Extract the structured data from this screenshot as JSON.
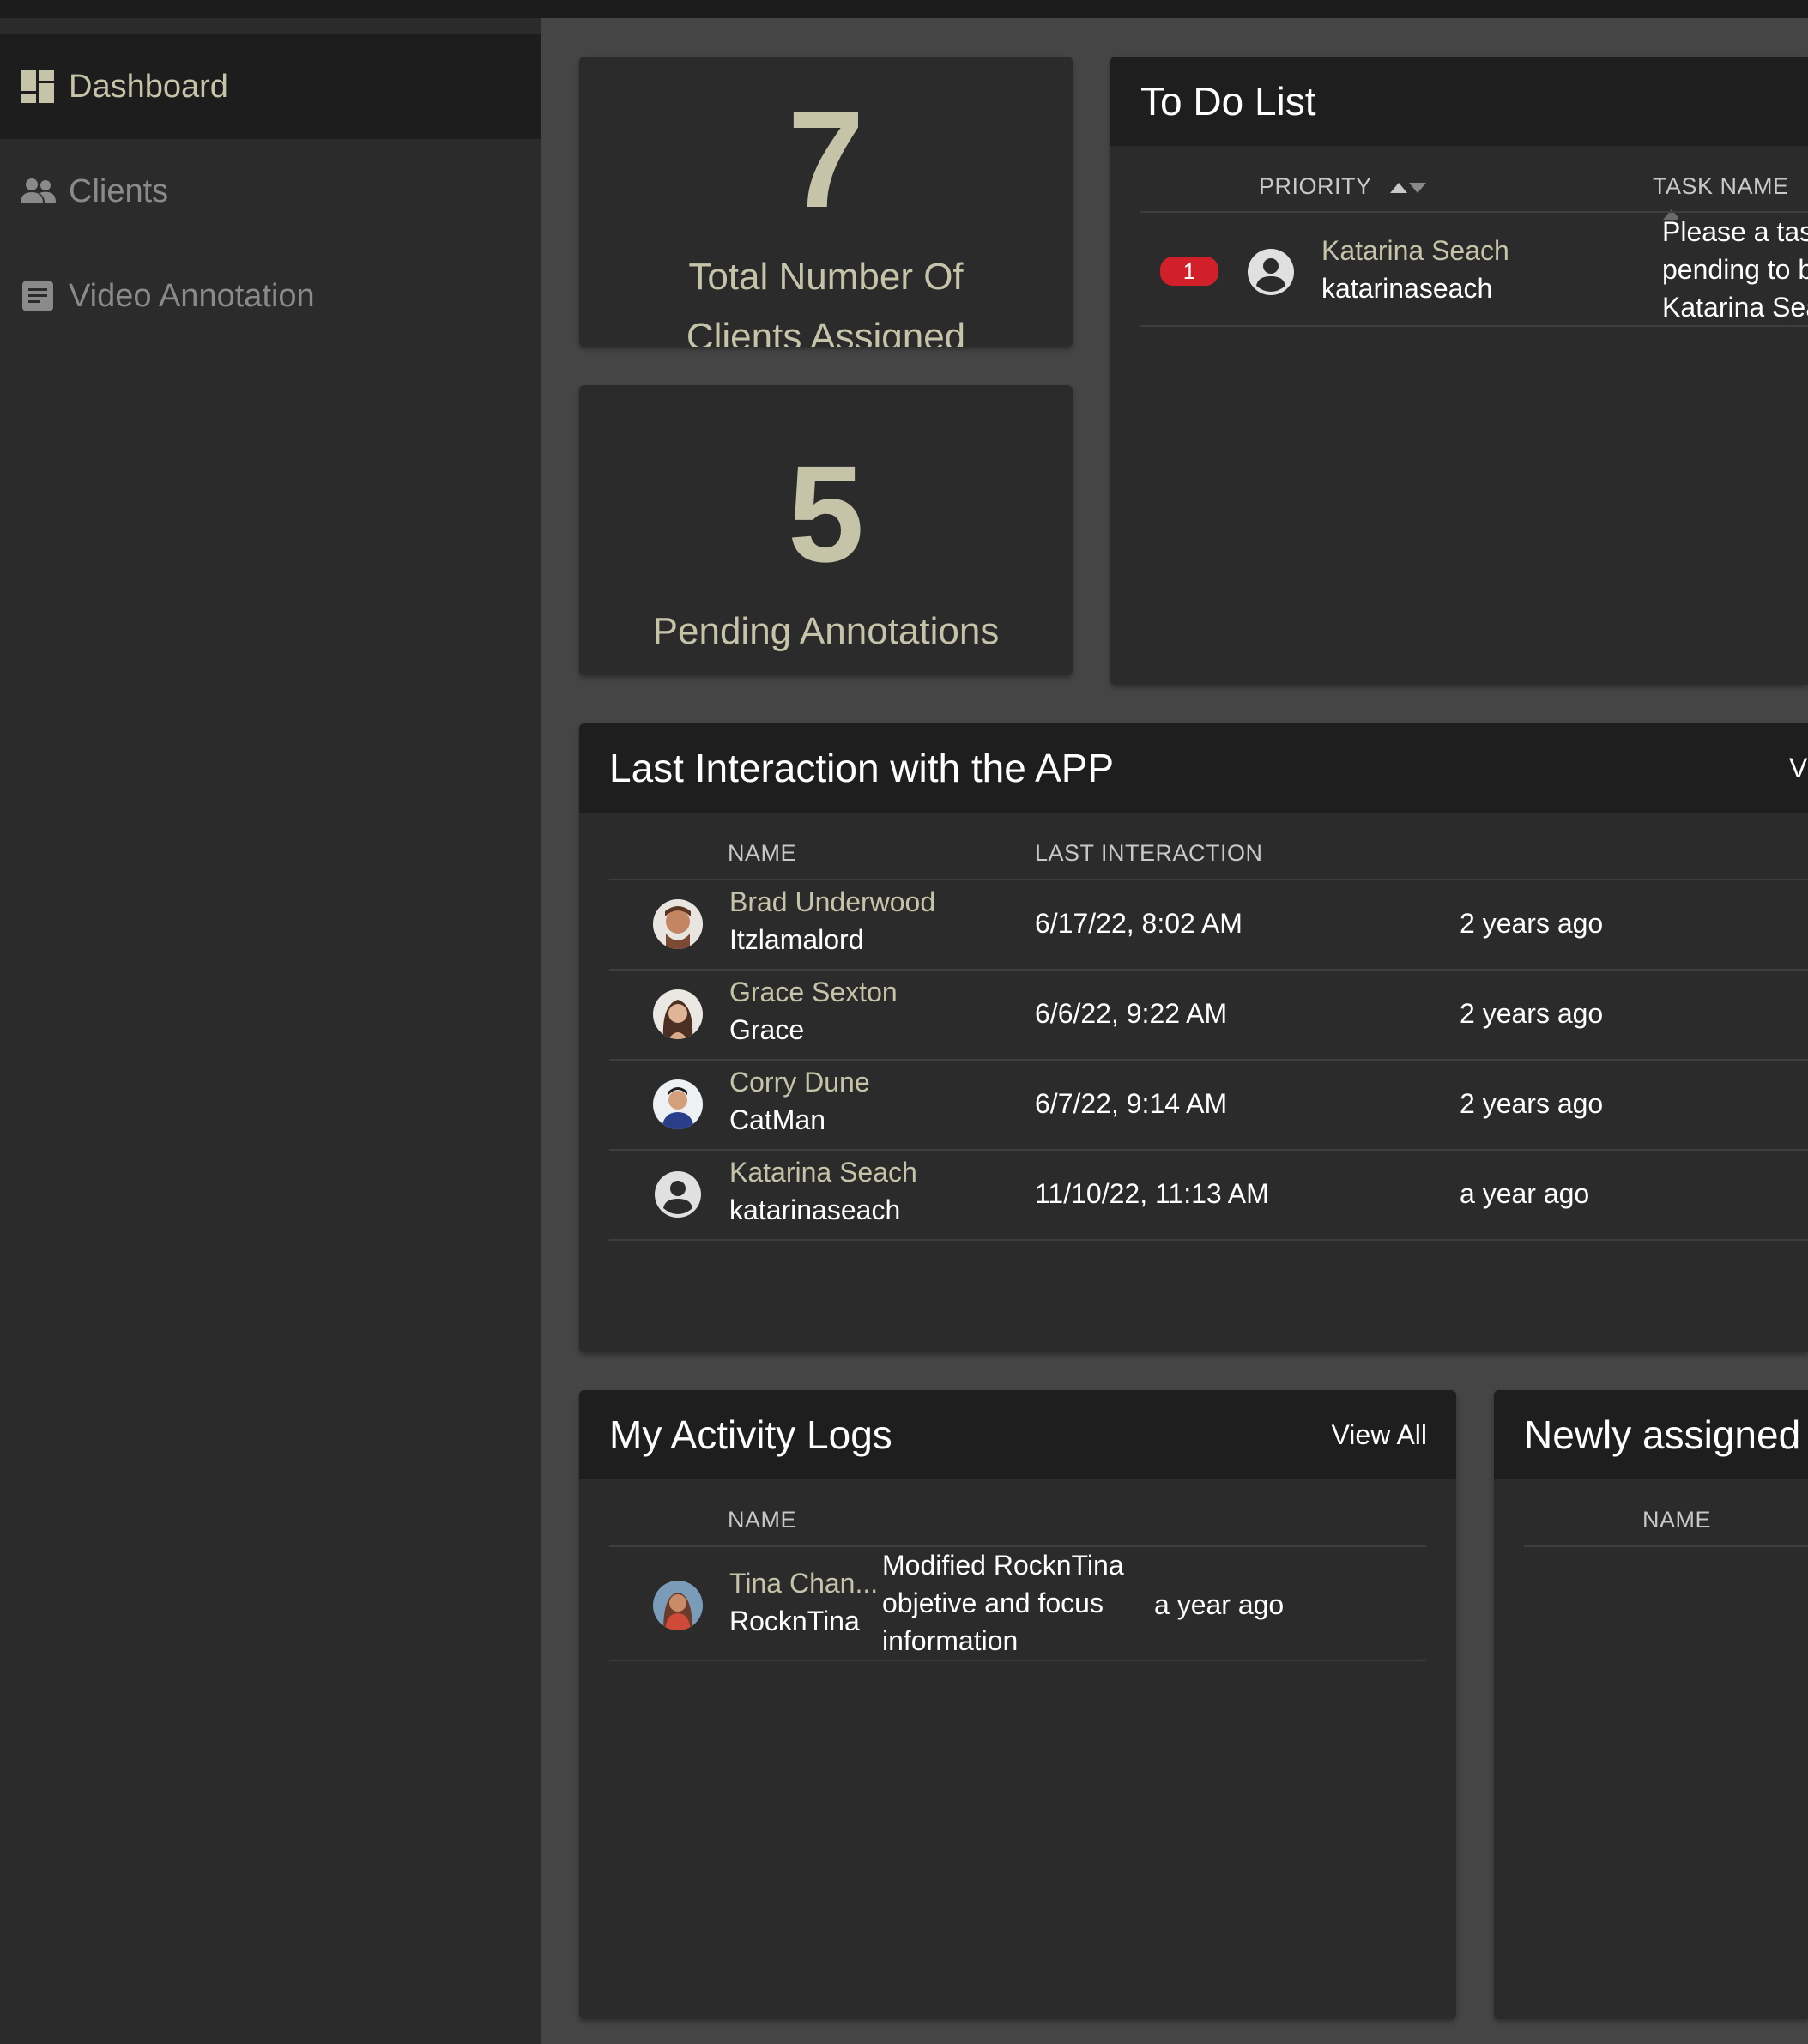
{
  "sidebar": {
    "items": [
      {
        "label": "Dashboard",
        "icon": "dashboard-icon",
        "active": true
      },
      {
        "label": "Clients",
        "icon": "users-icon",
        "active": false
      },
      {
        "label": "Video Annotation",
        "icon": "document-icon",
        "active": false
      }
    ]
  },
  "stats": {
    "clients": {
      "value": "7",
      "label": "Total Number Of Clients Assigned"
    },
    "annotations": {
      "value": "5",
      "label": "Pending Annotations"
    }
  },
  "todo": {
    "title": "To Do List",
    "columns": {
      "priority": "PRIORITY",
      "task": "TASK NAME"
    },
    "rows": [
      {
        "priority": "1",
        "name": "Katarina Seach",
        "username": "katarinaseach",
        "task_lines": [
          "Please a task",
          "pending to b",
          "Katarina Sea"
        ]
      }
    ]
  },
  "interactions": {
    "title": "Last Interaction with the APP",
    "view_all": "V",
    "columns": {
      "name": "NAME",
      "last": "LAST INTERACTION"
    },
    "rows": [
      {
        "name": "Brad Underwood",
        "username": "Itzlamalord",
        "date": "6/17/22, 8:02 AM",
        "ago": "2 years ago"
      },
      {
        "name": "Grace Sexton",
        "username": "Grace",
        "date": "6/6/22, 9:22 AM",
        "ago": "2 years ago"
      },
      {
        "name": "Corry Dune",
        "username": "CatMan",
        "date": "6/7/22, 9:14 AM",
        "ago": "2 years ago"
      },
      {
        "name": "Katarina Seach",
        "username": "katarinaseach",
        "date": "11/10/22, 11:13 AM",
        "ago": "a year ago"
      }
    ]
  },
  "activity": {
    "title": "My Activity Logs",
    "view_all": "View All",
    "columns": {
      "name": "NAME"
    },
    "rows": [
      {
        "name": "Tina Chan...",
        "username": "RocknTina",
        "desc_lines": [
          "Modified RocknTina",
          "objetive and focus",
          "information"
        ],
        "ago": "a year ago"
      }
    ]
  },
  "newly": {
    "title": "Newly assigned",
    "columns": {
      "name": "NAME"
    }
  },
  "colors": {
    "accent": "#c5c4a8",
    "badge": "#d1202a",
    "panel": "#2b2b2b",
    "header": "#1e1e1e"
  }
}
